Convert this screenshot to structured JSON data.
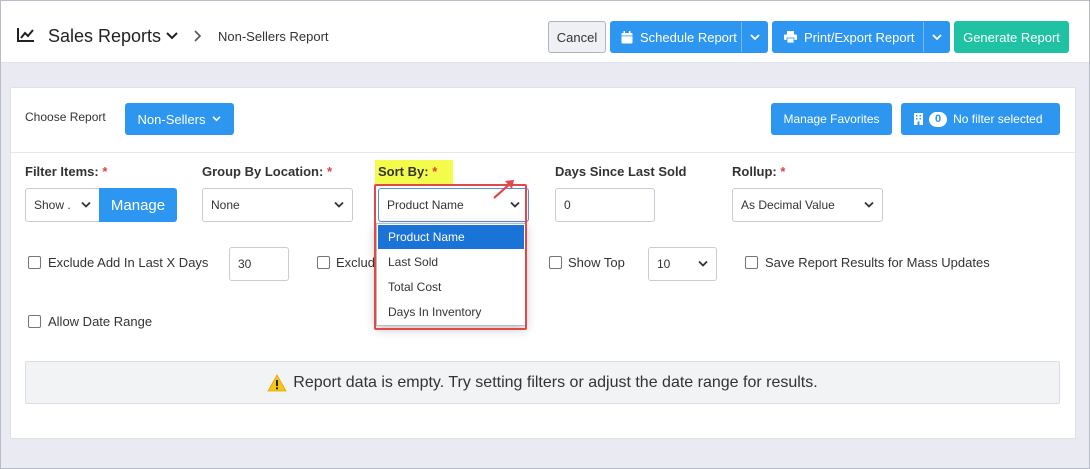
{
  "header": {
    "title": "Sales Reports",
    "breadcrumb": "Non-Sellers Report",
    "cancel_label": "Cancel",
    "schedule_label": "Schedule Report",
    "print_label": "Print/Export Report",
    "generate_label": "Generate Report"
  },
  "toolbar": {
    "choose_report_label": "Choose Report",
    "choose_report_value": "Non-Sellers",
    "manage_favorites_label": "Manage Favorites",
    "filter_count": "0",
    "filter_status": "No filter selected"
  },
  "filters": {
    "filter_items_label": "Filter Items:",
    "filter_items_value": "Show .",
    "manage_label": "Manage",
    "group_by_label": "Group By Location:",
    "group_by_value": "None",
    "sort_by_label": "Sort By:",
    "sort_by_value": "Product Name",
    "days_since_label": "Days Since Last Sold",
    "days_since_value": "0",
    "rollup_label": "Rollup:",
    "rollup_value": "As Decimal Value",
    "required_mark": "*"
  },
  "sort_options": [
    "Product Name",
    "Last Sold",
    "Total Cost",
    "Days In Inventory"
  ],
  "options": {
    "exclude_add_label": "Exclude Add In Last X Days",
    "exclude_add_value": "30",
    "exclude_partial_label": "Exclude",
    "show_top_label": "Show Top",
    "show_top_value": "10",
    "save_results_label": "Save Report Results for Mass Updates",
    "allow_date_label": "Allow Date Range"
  },
  "message": "Report data is empty. Try setting filters or adjust the date range for results.",
  "colors": {
    "primary": "#2d96f0",
    "teal": "#1fc3a4",
    "highlight": "#f3fb4b",
    "annotation_red": "#e0484b",
    "selected_option": "#1a73d6"
  }
}
